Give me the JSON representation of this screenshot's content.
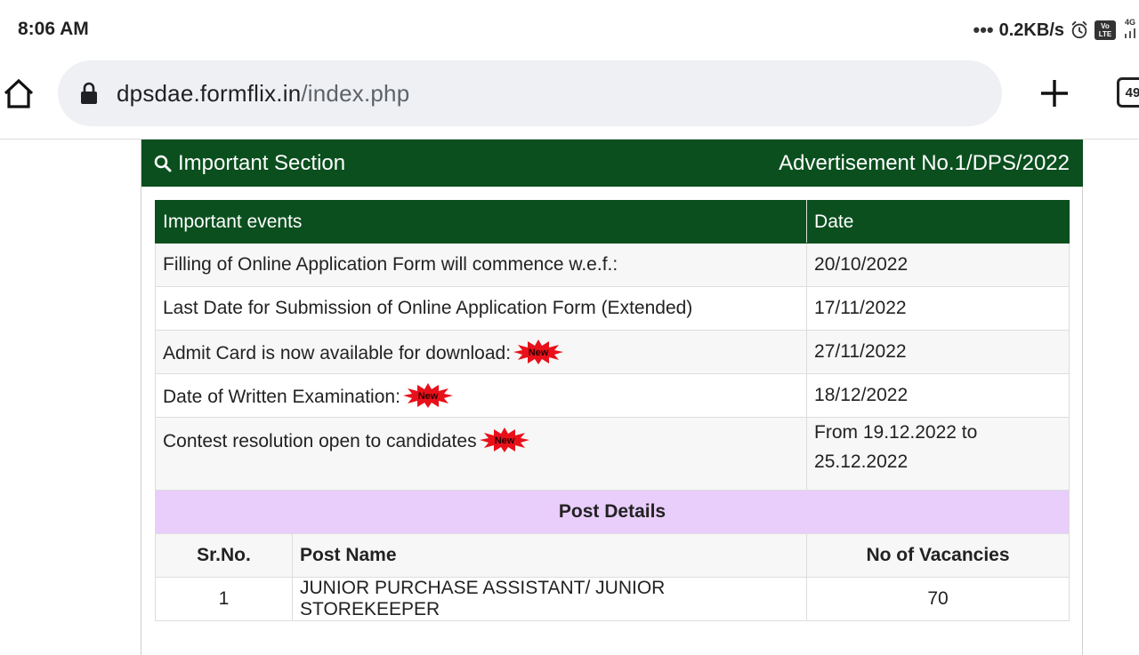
{
  "status_bar": {
    "time": "8:06 AM",
    "dots": "•••",
    "net_speed": "0.2KB/s",
    "volte_line1": "Vo",
    "volte_line2": "LTE",
    "network": "4G"
  },
  "browser": {
    "url_host": "dpsdae.formflix.in",
    "url_path": "/index.php",
    "tab_count": "49"
  },
  "panel": {
    "title": "Important Section",
    "advertisement": "Advertisement No.1/DPS/2022"
  },
  "events": {
    "headers": [
      "Important events",
      "Date"
    ],
    "rows": [
      {
        "event": "Filling of Online Application Form will commence w.e.f.:",
        "date": "20/10/2022",
        "is_new": false
      },
      {
        "event": "Last Date for Submission of Online Application Form (Extended)",
        "date": "17/11/2022",
        "is_new": false
      },
      {
        "event": "Admit Card is now available for download:",
        "date": "27/11/2022",
        "is_new": true
      },
      {
        "event": "Date of Written Examination:",
        "date": "18/12/2022",
        "is_new": true
      },
      {
        "event": "Contest resolution open to candidates",
        "date": "From 19.12.2022 to 25.12.2022",
        "is_new": true
      }
    ],
    "new_badge_label": "New"
  },
  "post_details": {
    "title": "Post Details",
    "headers": [
      "Sr.No.",
      "Post Name",
      "No of Vacancies"
    ],
    "rows": [
      {
        "sr": "1",
        "name": "JUNIOR PURCHASE ASSISTANT/ JUNIOR STOREKEEPER",
        "vacancies": "70"
      }
    ]
  },
  "colors": {
    "header_green": "#0b4f1e",
    "post_details_bg": "#e9cdfb",
    "badge_red": "#e8101a"
  }
}
